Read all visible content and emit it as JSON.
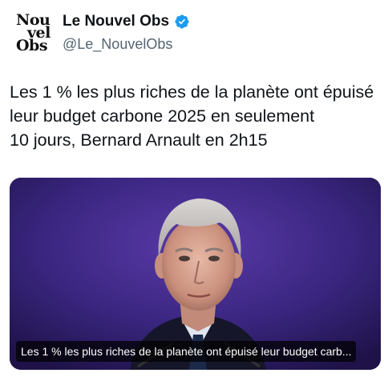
{
  "account": {
    "logo_lines": [
      "Nou",
      "vel",
      "Obs"
    ],
    "display_name": "Le Nouvel Obs",
    "handle": "@Le_NouvelObs",
    "verified_icon": "verified-badge-icon",
    "verified_color": "#1d9bf0"
  },
  "tweet": {
    "text": "Les 1 % les plus riches de la planète ont épuisé\nleur budget carbone 2025 en seulement\n10 jours, Bernard Arnault en 2h15"
  },
  "media": {
    "caption": "Les 1 % les plus riches de la planète ont épuisé leur budget carb...",
    "background_color": "#2b1a5e"
  }
}
